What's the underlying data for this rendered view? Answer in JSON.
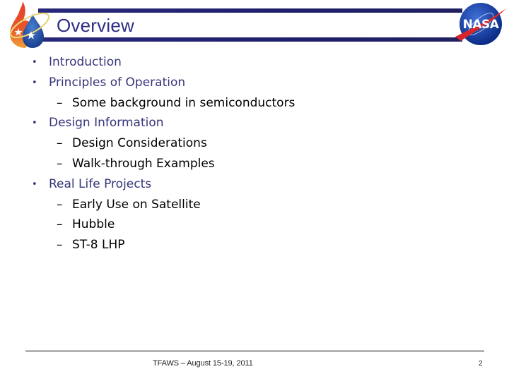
{
  "slide": {
    "title": "Overview",
    "bullets": [
      {
        "level": 1,
        "marker": "•",
        "text": "Introduction"
      },
      {
        "level": 1,
        "marker": "•",
        "text": "Principles of Operation"
      },
      {
        "level": 2,
        "marker": "–",
        "text": "Some background in semiconductors"
      },
      {
        "level": 1,
        "marker": "•",
        "text": "Design Information"
      },
      {
        "level": 2,
        "marker": "–",
        "text": "Design Considerations"
      },
      {
        "level": 2,
        "marker": "–",
        "text": "Walk-through Examples"
      },
      {
        "level": 1,
        "marker": "•",
        "text": "Real Life Projects"
      },
      {
        "level": 2,
        "marker": "–",
        "text": "Early Use on Satellite"
      },
      {
        "level": 2,
        "marker": "–",
        "text": "Hubble"
      },
      {
        "level": 2,
        "marker": "–",
        "text": "ST-8 LHP"
      }
    ],
    "footer": {
      "text": "TFAWS – August 15-19, 2011",
      "page_number": "2"
    },
    "logos": {
      "left": "tfaws-flame-drop-logo",
      "right": "nasa-meatball-logo",
      "nasa_text": "NASA"
    },
    "colors": {
      "title": "#2d2e83",
      "header_bar": "#1e1f6b",
      "level1_text": "#35357a",
      "level2_text": "#000000"
    }
  }
}
